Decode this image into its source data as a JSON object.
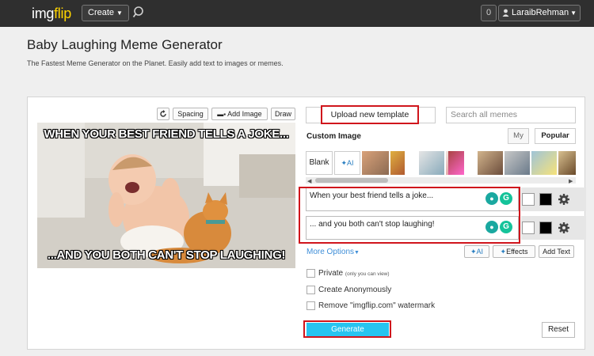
{
  "nav": {
    "logo_img": "img",
    "logo_flip": "flip",
    "create_label": "Create",
    "notification_count": "0",
    "username": "LaraibRehman",
    "colors": {
      "bar": "#2f2f2f",
      "logo_accent": "#ffd400"
    }
  },
  "header": {
    "title": "Baby Laughing Meme Generator",
    "subtitle": "The Fastest Meme Generator on the Planet. Easily  add text to images or memes."
  },
  "toolbar": {
    "rotate_icon": "rotate-icon",
    "spacing_label": "Spacing",
    "add_image_label": "Add Image",
    "draw_label": "Draw"
  },
  "meme": {
    "top_text": "WHEN YOUR BEST FRIEND TELLS A JOKE...",
    "bottom_text": "...AND YOU BOTH CAN'T STOP LAUGHING!"
  },
  "templates": {
    "upload_label": "Upload new  template",
    "search_placeholder": "Search all memes",
    "custom_image_label": "Custom Image",
    "tab_my": "My",
    "tab_popular": "Popular",
    "blank_label": "Blank",
    "ai_label": "AI"
  },
  "text_boxes": [
    {
      "value": "When your best friend tells a joke...",
      "color": "#ffffff",
      "outline": "#000000"
    },
    {
      "value": "... and you both can't stop laughing!",
      "color": "#ffffff",
      "outline": "#000000"
    }
  ],
  "options": {
    "more_options_label": "More Options",
    "ai_button": "AI",
    "effects_button": "Effects",
    "add_text_button": "Add Text",
    "private_label": "Private",
    "private_note": "(only you can view)",
    "anonymous_label": "Create Anonymously",
    "watermark_label": "Remove \"imgflip.com\" watermark"
  },
  "actions": {
    "generate_label": "Generate",
    "reset_label": "Reset",
    "generate_color": "#27c4f0",
    "highlight_color": "#d0151c"
  }
}
